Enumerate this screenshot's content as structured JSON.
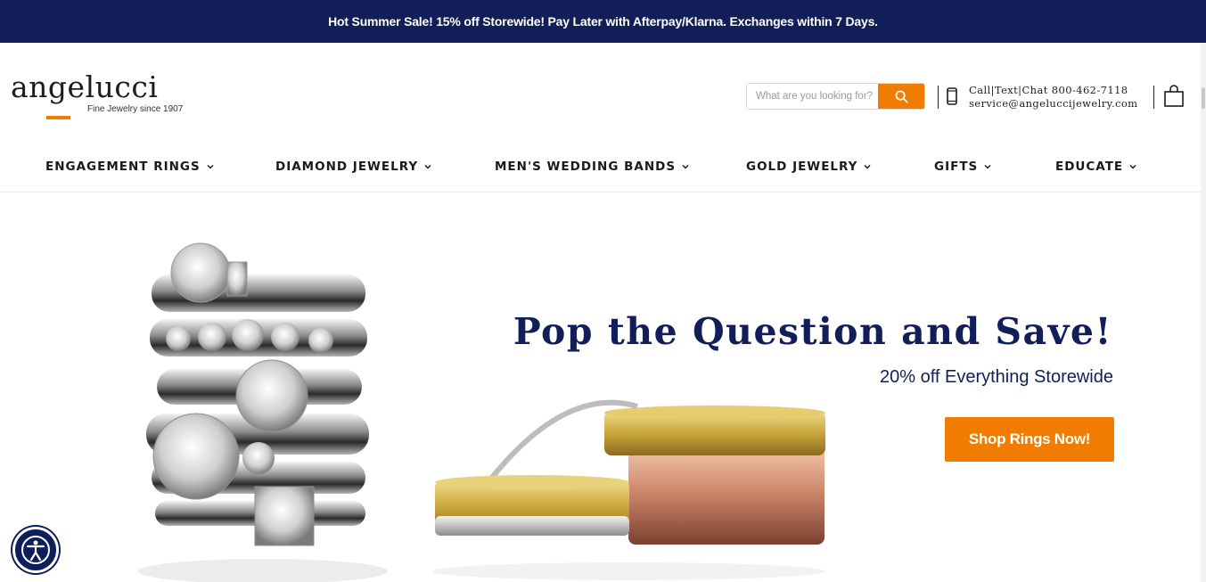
{
  "announcement": "Hot Summer Sale! 15% off Storewide! Pay Later with Afterpay/Klarna. Exchanges within 7 Days.",
  "logo": {
    "name": "angelucci",
    "tagline": "Fine Jewelry since 1907"
  },
  "search": {
    "placeholder": "What are you looking for?",
    "icon": "search-icon"
  },
  "contact": {
    "line1": "Call|Text|Chat 800-462-7118",
    "line2": "service@angeluccijewelry.com",
    "icon": "mobile-phone-icon"
  },
  "cart": {
    "icon": "shopping-bag-icon"
  },
  "nav": [
    {
      "label": "ENGAGEMENT RINGS"
    },
    {
      "label": "DIAMOND JEWELRY"
    },
    {
      "label": "MEN'S WEDDING BANDS"
    },
    {
      "label": "GOLD JEWELRY"
    },
    {
      "label": "GIFTS"
    },
    {
      "label": "EDUCATE"
    }
  ],
  "hero": {
    "title": "Pop the Question and Save!",
    "subtitle": "20% off Everything Storewide",
    "button": "Shop Rings Now!"
  },
  "accessibility": {
    "icon": "accessibility-icon"
  },
  "colors": {
    "navy": "#111e58",
    "accent": "#f07c00"
  }
}
